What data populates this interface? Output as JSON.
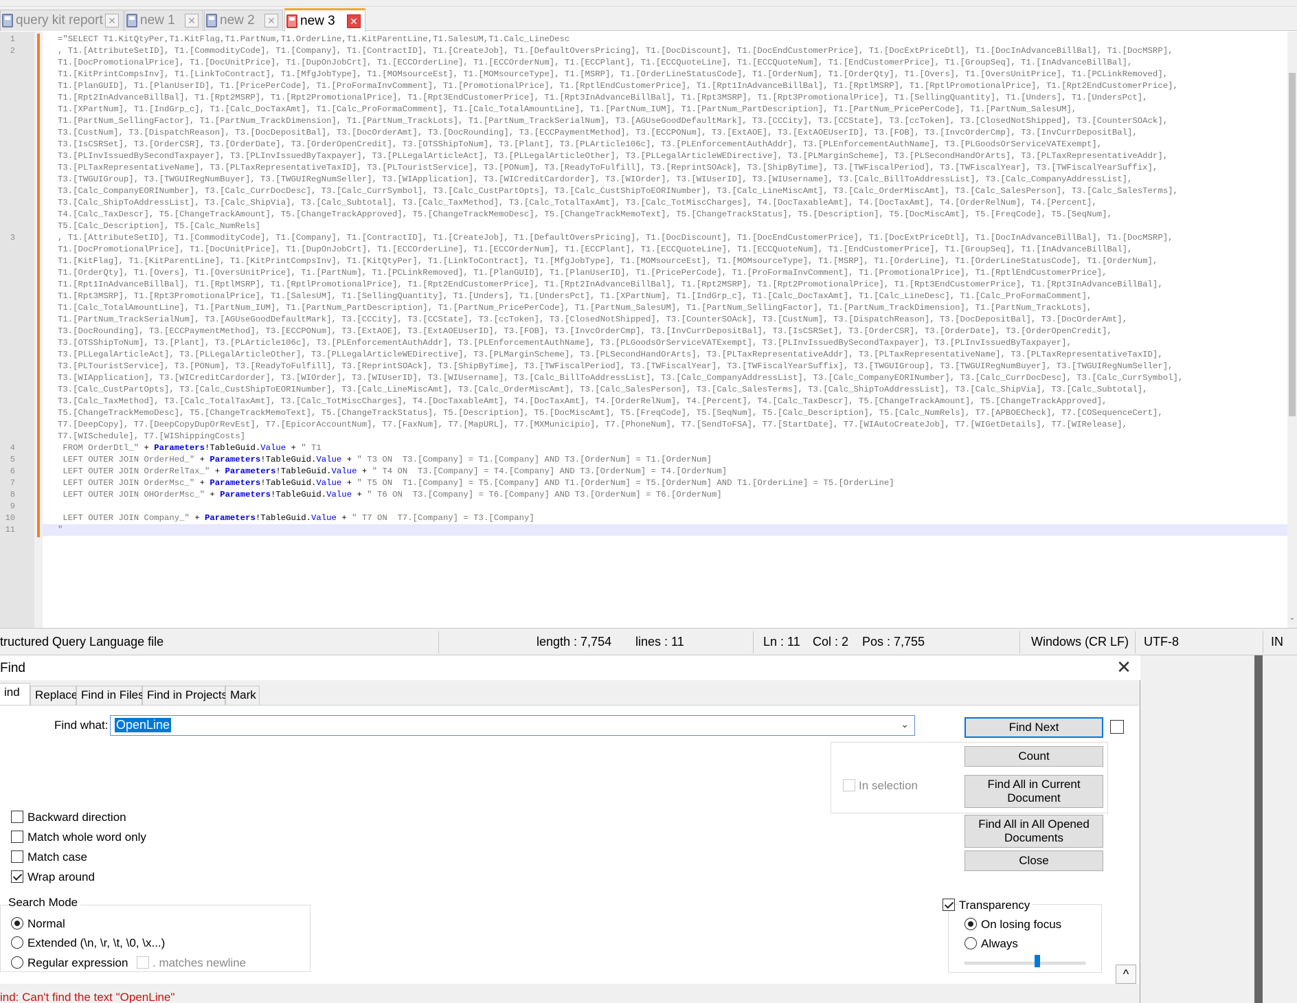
{
  "tabs": [
    {
      "label": "query kit report",
      "active": false
    },
    {
      "label": "new 1",
      "active": false
    },
    {
      "label": "new 2",
      "active": false
    },
    {
      "label": "new 3",
      "active": true
    }
  ],
  "editor": {
    "line_numbers": [
      "1",
      "2",
      "3",
      "4",
      "5",
      "6",
      "7",
      "8",
      "9",
      "10",
      "11"
    ],
    "code_lines": [
      "=\"SELECT T1.KitQtyPer,T1.KitFlag,T1.PartNum,T1.OrderLine,T1.KitParentLine,T1.SalesUM,T1.Calc_LineDesc",
      ", T1.[AttributeSetID], T1.[CommodityCode], T1.[Company], T1.[ContractID], T1.[CreateJob], T1.[DefaultOversPricing], T1.[DocDiscount], T1.[DocEndCustomerPrice], T1.[DocExtPriceDtl], T1.[DocInAdvanceBillBal], T1.[DocMSRP],",
      "T1.[DocPromotionalPrice], T1.[DocUnitPrice], T1.[DupOnJobCrt], T1.[ECCOrderLine], T1.[ECCOrderNum], T1.[ECCPlant], T1.[ECCQuoteLine], T1.[ECCQuoteNum], T1.[EndCustomerPrice], T1.[GroupSeq], T1.[InAdvanceBillBal],",
      "T1.[KitPrintCompsInv], T1.[LinkToContract], T1.[MfgJobType], T1.[MOMsourceEst], T1.[MOMsourceType], T1.[MSRP], T1.[OrderLineStatusCode], T1.[OrderNum], T1.[OrderQty], T1.[Overs], T1.[OversUnitPrice], T1.[PCLinkRemoved],",
      "T1.[PlanGUID], T1.[PlanUserID], T1.[PricePerCode], T1.[ProFormaInvComment], T1.[PromotionalPrice], T1.[RptlEndCustomerPrice], T1.[Rpt1InAdvanceBillBal], T1.[RptlMSRP], T1.[RptlPromotionalPrice], T1.[Rpt2EndCustomerPrice],",
      "T1.[Rpt2InAdvanceBillBal], T1.[Rpt2MSRP], T1.[Rpt2PromotionalPrice], T1.[Rpt3EndCustomerPrice], T1.[Rpt3InAdvanceBillBal], T1.[Rpt3MSRP], T1.[Rpt3PromotionalPrice], T1.[SellingQuantity], T1.[Unders], T1.[UndersPct],",
      "T1.[XPartNum], T1.[IndGrp_c], T1.[Calc_DocTaxAmt], T1.[Calc_ProFormaComment], T1.[Calc_TotalAmountLine], T1.[PartNum_IUM], T1.[PartNum_PartDescription], T1.[PartNum_PricePerCode], T1.[PartNum_SalesUM],",
      "T1.[PartNum_SellingFactor], T1.[PartNum_TrackDimension], T1.[PartNum_TrackLots], T1.[PartNum_TrackSerialNum], T3.[AGUseGoodDefaultMark], T3.[CCCity], T3.[CCState], T3.[ccToken], T3.[ClosedNotShipped], T3.[CounterSOAck],",
      "T3.[CustNum], T3.[DispatchReason], T3.[DocDepositBal], T3.[DocOrderAmt], T3.[DocRounding], T3.[ECCPaymentMethod], T3.[ECCPONum], T3.[ExtAOE], T3.[ExtAOEUserID], T3.[FOB], T3.[InvcOrderCmp], T3.[InvCurrDepositBal],",
      "T3.[IsCSRSet], T3.[OrderCSR], T3.[OrderDate], T3.[OrderOpenCredit], T3.[OTSShipToNum], T3.[Plant], T3.[PLArticle106c], T3.[PLEnforcementAuthAddr], T3.[PLEnforcementAuthName], T3.[PLGoodsOrServiceVATExempt],",
      "T3.[PLInvIssuedBySecondTaxpayer], T3.[PLInvIssuedByTaxpayer], T3.[PLLegalArticleAct], T3.[PLLegalArticleOther], T3.[PLLegalArticleWEDirective], T3.[PLMarginScheme], T3.[PLSecondHandOrArts], T3.[PLTaxRepresentativeAddr],",
      "T3.[PLTaxRepresentativeName], T3.[PLTaxRepresentativeTaxID], T3.[PLTouristService], T3.[PONum], T3.[ReadyToFulfill], T3.[ReprintSOAck], T3.[ShipByTime], T3.[TWFiscalPeriod], T3.[TWFiscalYear], T3.[TWFiscalYearSuffix],",
      "T3.[TWGUIGroup], T3.[TWGUIRegNumBuyer], T3.[TWGUIRegNumSeller], T3.[WIApplication], T3.[WICreditCardorder], T3.[WIOrder], T3.[WIUserID], T3.[WIUsername], T3.[Calc_BillToAddressList], T3.[Calc_CompanyAddressList],",
      "T3.[Calc_CompanyEORINumber], T3.[Calc_CurrDocDesc], T3.[Calc_CurrSymbol], T3.[Calc_CustPartOpts], T3.[Calc_CustShipToEORINumber], T3.[Calc_LineMiscAmt], T3.[Calc_OrderMiscAmt], T3.[Calc_SalesPerson], T3.[Calc_SalesTerms],",
      "T3.[Calc_ShipToAddressList], T3.[Calc_ShipVia], T3.[Calc_Subtotal], T3.[Calc_TaxMethod], T3.[Calc_TotalTaxAmt], T3.[Calc_TotMiscCharges], T4.[DocTaxableAmt], T4.[DocTaxAmt], T4.[OrderRelNum], T4.[Percent],",
      "T4.[Calc_TaxDescr], T5.[ChangeTrackAmount], T5.[ChangeTrackApproved], T5.[ChangeTrackMemoDesc], T5.[ChangeTrackMemoText], T5.[ChangeTrackStatus], T5.[Description], T5.[DocMiscAmt], T5.[FreqCode], T5.[SeqNum],",
      "T5.[Calc_Description], T5.[Calc_NumRels]",
      ", T1.[AttributeSetID], T1.[CommodityCode], T1.[Company], T1.[ContractID], T1.[CreateJob], T1.[DefaultOversPricing], T1.[DocDiscount], T1.[DocEndCustomerPrice], T1.[DocExtPriceDtl], T1.[DocInAdvanceBillBal], T1.[DocMSRP],",
      "T1.[DocPromotionalPrice], T1.[DocUnitPrice], T1.[DupOnJobCrt], T1.[ECCOrderLine], T1.[ECCOrderNum], T1.[ECCPlant], T1.[ECCQuoteLine], T1.[ECCQuoteNum], T1.[EndCustomerPrice], T1.[GroupSeq], T1.[InAdvanceBillBal],",
      "T1.[KitFlag], T1.[KitParentLine], T1.[KitPrintCompsInv], T1.[KitQtyPer], T1.[LinkToContract], T1.[MfgJobType], T1.[MOMsourceEst], T1.[MOMsourceType], T1.[MSRP], T1.[OrderLine], T1.[OrderLineStatusCode], T1.[OrderNum],",
      "T1.[OrderQty], T1.[Overs], T1.[OversUnitPrice], T1.[PartNum], T1.[PCLinkRemoved], T1.[PlanGUID], T1.[PlanUserID], T1.[PricePerCode], T1.[ProFormaInvComment], T1.[PromotionalPrice], T1.[RptlEndCustomerPrice],",
      "T1.[Rpt1InAdvanceBillBal], T1.[RptlMSRP], T1.[RptlPromotionalPrice], T1.[Rpt2EndCustomerPrice], T1.[Rpt2InAdvanceBillBal], T1.[Rpt2MSRP], T1.[Rpt2PromotionalPrice], T1.[Rpt3EndCustomerPrice], T1.[Rpt3InAdvanceBillBal],",
      "T1.[Rpt3MSRP], T1.[Rpt3PromotionalPrice], T1.[SalesUM], T1.[SellingQuantity], T1.[Unders], T1.[UndersPct], T1.[XPartNum], T1.[IndGrp_c], T1.[Calc_DocTaxAmt], T1.[Calc_LineDesc], T1.[Calc_ProFormaComment],",
      "T1.[Calc_TotalAmountLine], T1.[PartNum_IUM], T1.[PartNum_PartDescription], T1.[PartNum_PricePerCode], T1.[PartNum_SalesUM], T1.[PartNum_SellingFactor], T1.[PartNum_TrackDimension], T1.[PartNum_TrackLots],",
      "T1.[PartNum_TrackSerialNum], T3.[AGUseGoodDefaultMark], T3.[CCCity], T3.[CCState], T3.[ccToken], T3.[ClosedNotShipped], T3.[CounterSOAck], T3.[CustNum], T3.[DispatchReason], T3.[DocDepositBal], T3.[DocOrderAmt],",
      "T3.[DocRounding], T3.[ECCPaymentMethod], T3.[ECCPONum], T3.[ExtAOE], T3.[ExtAOEUserID], T3.[FOB], T3.[InvcOrderCmp], T3.[InvCurrDepositBal], T3.[IsCSRSet], T3.[OrderCSR], T3.[OrderDate], T3.[OrderOpenCredit],",
      "T3.[OTSShipToNum], T3.[Plant], T3.[PLArticle106c], T3.[PLEnforcementAuthAddr], T3.[PLEnforcementAuthName], T3.[PLGoodsOrServiceVATExempt], T3.[PLInvIssuedBySecondTaxpayer], T3.[PLInvIssuedByTaxpayer],",
      "T3.[PLLegalArticleAct], T3.[PLLegalArticleOther], T3.[PLLegalArticleWEDirective], T3.[PLMarginScheme], T3.[PLSecondHandOrArts], T3.[PLTaxRepresentativeAddr], T3.[PLTaxRepresentativeName], T3.[PLTaxRepresentativeTaxID],",
      "T3.[PLTouristService], T3.[PONum], T3.[ReadyToFulfill], T3.[ReprintSOAck], T3.[ShipByTime], T3.[TWFiscalPeriod], T3.[TWFiscalYear], T3.[TWFiscalYearSuffix], T3.[TWGUIGroup], T3.[TWGUIRegNumBuyer], T3.[TWGUIRegNumSeller],",
      "T3.[WIApplication], T3.[WICreditCardorder], T3.[WIOrder], T3.[WIUserID], T3.[WIUsername], T3.[Calc_BillToAddressList], T3.[Calc_CompanyAddressList], T3.[Calc_CompanyEORINumber], T3.[Calc_CurrDocDesc], T3.[Calc_CurrSymbol],",
      "T3.[Calc_CustPartOpts], T3.[Calc_CustShipToEORINumber], T3.[Calc_LineMiscAmt], T3.[Calc_OrderMiscAmt], T3.[Calc_SalesPerson], T3.[Calc_SalesTerms], T3.[Calc_ShipToAddressList], T3.[Calc_ShipVia], T3.[Calc_Subtotal],",
      "T3.[Calc_TaxMethod], T3.[Calc_TotalTaxAmt], T3.[Calc_TotMiscCharges], T4.[DocTaxableAmt], T4.[DocTaxAmt], T4.[OrderRelNum], T4.[Percent], T4.[Calc_TaxDescr], T5.[ChangeTrackAmount], T5.[ChangeTrackApproved],",
      "T5.[ChangeTrackMemoDesc], T5.[ChangeTrackMemoText], T5.[ChangeTrackStatus], T5.[Description], T5.[DocMiscAmt], T5.[FreqCode], T5.[SeqNum], T5.[Calc_Description], T5.[Calc_NumRels], T7.[APBOECheck], T7.[COSequenceCert],",
      "T7.[DeepCopy], T7.[DeepCopyDupOrRevEst], T7.[EpicorAccountNum], T7.[FaxNum], T7.[MapURL], T7.[MXMunicipio], T7.[PhoneNum], T7.[SendToFSA], T7.[StartDate], T7.[WIAutoCreateJob], T7.[WIGetDetails], T7.[WIRelease],",
      "T7.[WISchedule], T7.[WIShippingCosts]"
    ],
    "join_lines": [
      {
        "pre": " FROM OrderDtl_\" ",
        "post": "\" T1"
      },
      {
        "pre": " LEFT OUTER JOIN OrderHed_\" ",
        "post": "\" T3 ON  T3.[Company] = T1.[Company] AND T3.[OrderNum] = T1.[OrderNum]"
      },
      {
        "pre": " LEFT OUTER JOIN OrderRelTax_\" ",
        "post": "\" T4 ON  T3.[Company] = T4.[Company] AND T3.[OrderNum] = T4.[OrderNum]"
      },
      {
        "pre": " LEFT OUTER JOIN OrderMsc_\" ",
        "post": "\" T5 ON  T1.[Company] = T5.[Company] AND T1.[OrderNum] = T5.[OrderNum] AND T1.[OrderLine] = T5.[OrderLine]"
      },
      {
        "pre": " LEFT OUTER JOIN OHOrderMsc_\" ",
        "post": "\" T6 ON  T3.[Company] = T6.[Company] AND T3.[OrderNum] = T6.[OrderNum]"
      },
      {
        "pre": "",
        "post": ""
      },
      {
        "pre": " LEFT OUTER JOIN Company_\" ",
        "post": "\" T7 ON  T7.[Company] = T3.[Company]"
      }
    ],
    "param_tokens": {
      "plus": "+",
      "params": "Parameters",
      "bang": "!",
      "table": "TableGuid",
      "dot": ".",
      "value": "Value",
      "plus2": " + "
    },
    "last_line": "\""
  },
  "statusbar": {
    "file_type": "tructured Query Language file",
    "length": "length : 7,754",
    "lines": "lines : 11",
    "ln": "Ln : 11",
    "col": "Col : 2",
    "pos": "Pos : 7,755",
    "eol": "Windows (CR LF)",
    "encoding": "UTF-8",
    "ins": "IN"
  },
  "dialog": {
    "title": "Find",
    "tabs": [
      "ind",
      "Replace",
      "Find in Files",
      "Find in Projects",
      "Mark"
    ],
    "find_what_label": "Find what:",
    "find_what_value": "OpenLine",
    "buttons": {
      "find_next": "Find Next",
      "count": "Count",
      "find_all_current_1": "Find All in Current",
      "find_all_current_2": "Document",
      "find_all_opened_1": "Find All in All Opened",
      "find_all_opened_2": "Documents",
      "close": "Close"
    },
    "in_selection": "In selection",
    "options": {
      "backward": "Backward direction",
      "whole_word": "Match whole word only",
      "match_case": "Match case",
      "wrap_around": "Wrap around"
    },
    "search_mode": {
      "label": "Search Mode",
      "normal": "Normal",
      "extended": "Extended (\\n, \\r, \\t, \\0, \\x...)",
      "regex": "Regular expression",
      "matches_newline": ". matches newline"
    },
    "transparency": {
      "label": "Transparency",
      "on_losing_focus": "On losing focus",
      "always": "Always",
      "level": 0.6
    },
    "collapse": "^",
    "status_message": "ind: Can't find the text \"OpenLine\""
  }
}
